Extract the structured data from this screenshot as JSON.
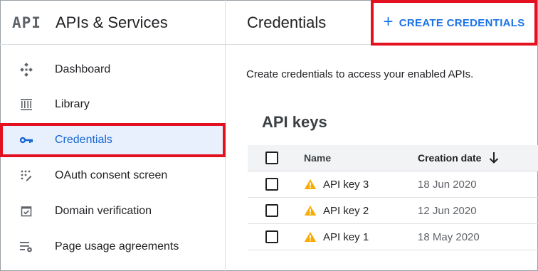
{
  "header": {
    "logo_text": "API",
    "app_title": "APIs & Services",
    "page_title": "Credentials",
    "create_button": {
      "icon": "plus-icon",
      "label": "CREATE CREDENTIALS"
    }
  },
  "sidebar": {
    "items": [
      {
        "label": "Dashboard",
        "icon": "dashboard-icon",
        "active": false
      },
      {
        "label": "Library",
        "icon": "library-icon",
        "active": false
      },
      {
        "label": "Credentials",
        "icon": "key-icon",
        "active": true
      },
      {
        "label": "OAuth consent screen",
        "icon": "oauth-consent-icon",
        "active": false
      },
      {
        "label": "Domain verification",
        "icon": "domain-verification-icon",
        "active": false
      },
      {
        "label": "Page usage agreements",
        "icon": "page-usage-icon",
        "active": false
      }
    ]
  },
  "main": {
    "intro": "Create credentials to access your enabled APIs.",
    "section_title": "API keys",
    "table": {
      "columns": {
        "name": "Name",
        "date": "Creation date"
      },
      "rows": [
        {
          "name": "API key 3",
          "date": "18 Jun 2020",
          "icon": "warning-icon"
        },
        {
          "name": "API key 2",
          "date": "12 Jun 2020",
          "icon": "warning-icon"
        },
        {
          "name": "API key 1",
          "date": "18 May 2020",
          "icon": "warning-icon"
        }
      ]
    }
  },
  "colors": {
    "accent": "#1a73e8",
    "highlight": "#e3101f",
    "active_bg": "#e8f0fe",
    "warning": "#f9ab00"
  }
}
